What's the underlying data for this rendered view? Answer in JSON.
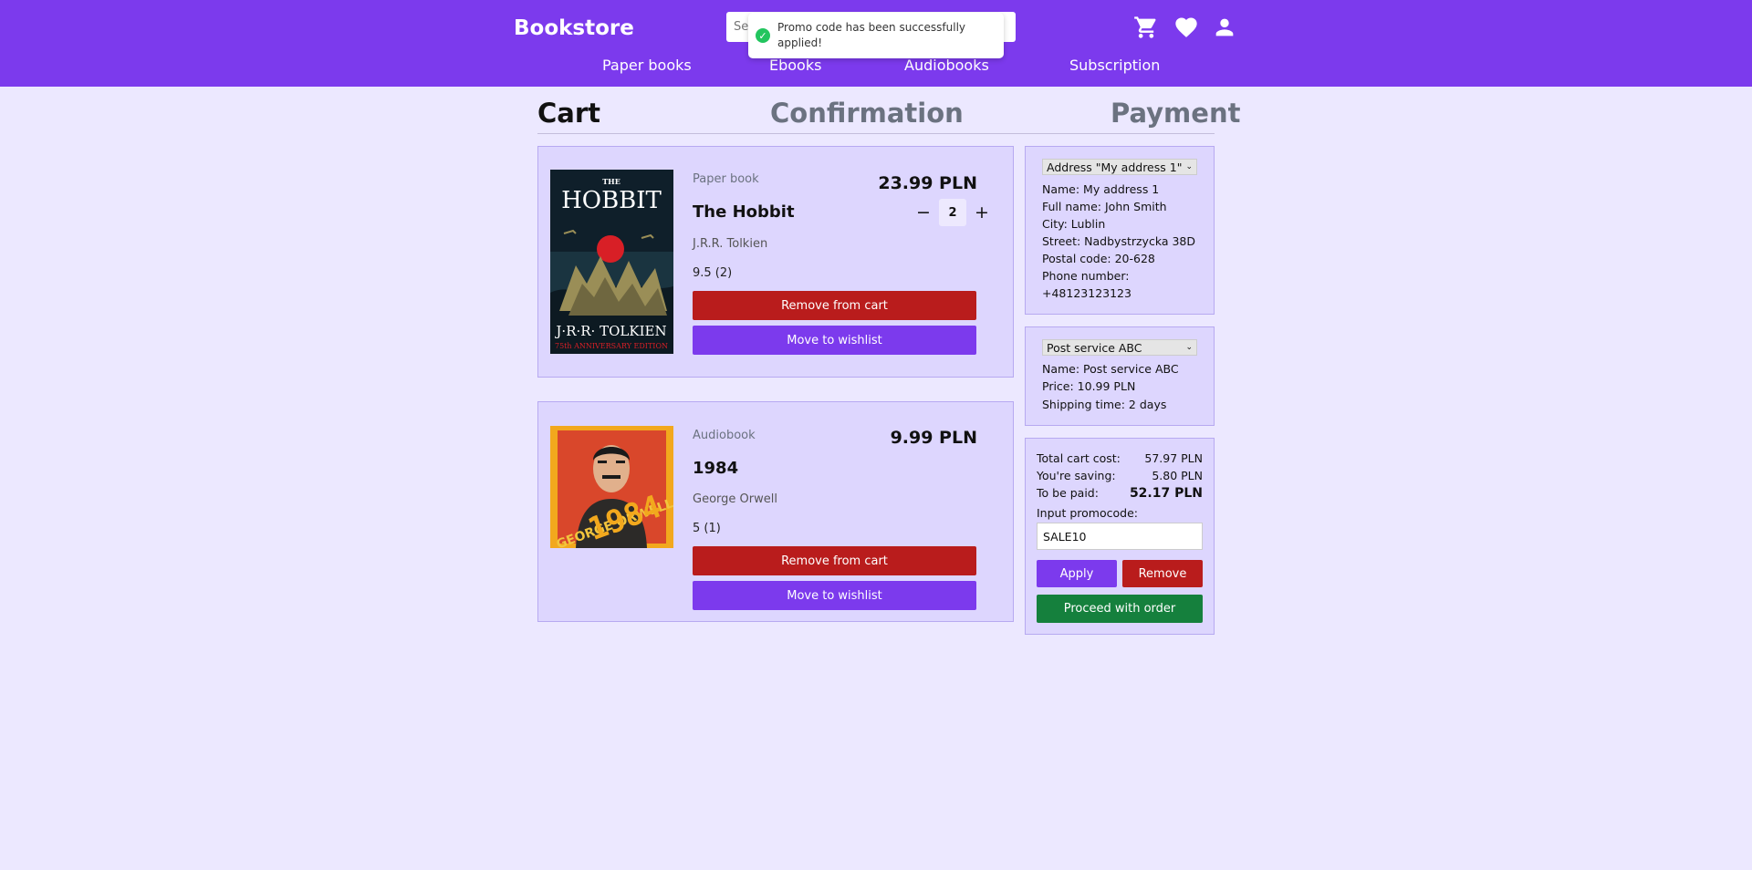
{
  "header": {
    "logo": "Bookstore",
    "search_placeholder": "Search",
    "nav": [
      "Paper books",
      "Ebooks",
      "Audiobooks",
      "Subscription"
    ],
    "icons": [
      "cart-icon",
      "heart-icon",
      "user-icon"
    ]
  },
  "toast": {
    "message": "Promo code has been successfully applied!",
    "status_color": "#22c55e"
  },
  "steps": [
    {
      "label": "Cart",
      "active": true
    },
    {
      "label": "Confirmation",
      "active": false
    },
    {
      "label": "Payment",
      "active": false
    }
  ],
  "items": [
    {
      "type": "Paper book",
      "title": "The Hobbit",
      "author": "J.R.R. Tolkien",
      "rating": "9.5 (2)",
      "price": "23.99 PLN",
      "quantity": "2",
      "remove_label": "Remove from cart",
      "wishlist_label": "Move to wishlist",
      "cover": {
        "title": "THE HOBBIT",
        "author": "J·R·R· TOLKIEN",
        "edition": "75th ANNIVERSARY EDITION"
      }
    },
    {
      "type": "Audiobook",
      "title": "1984",
      "author": "George Orwell",
      "rating": "5 (1)",
      "price": "9.99 PLN",
      "remove_label": "Remove from cart",
      "wishlist_label": "Move to wishlist",
      "cover": {
        "title": "1984",
        "author": "GEORGE ORWELL"
      }
    }
  ],
  "address": {
    "selected": "Address \"My address 1\"",
    "lines": [
      "Name: My address 1",
      "Full name: John Smith",
      "City: Lublin",
      "Street: Nadbystrzycka 38D",
      "Postal code: 20-628",
      "Phone number:",
      "+48123123123"
    ]
  },
  "shipping": {
    "selected": "Post service ABC",
    "lines": [
      "Name: Post service ABC",
      "Price: 10.99 PLN",
      "Shipping time: 2 days"
    ]
  },
  "summary": {
    "total_label": "Total cart cost:",
    "total_value": "57.97 PLN",
    "saving_label": "You're saving:",
    "saving_value": "5.80 PLN",
    "paid_label": "To be paid:",
    "paid_value": "52.17 PLN",
    "promo_label": "Input promocode:",
    "promo_value": "SALE10",
    "apply_label": "Apply",
    "remove_label": "Remove",
    "proceed_label": "Proceed with order"
  },
  "colors": {
    "brand": "#7c3aed",
    "danger": "#b91c1c",
    "success": "#15803d",
    "background": "#ece8ff",
    "panel": "#ddd6fe"
  }
}
